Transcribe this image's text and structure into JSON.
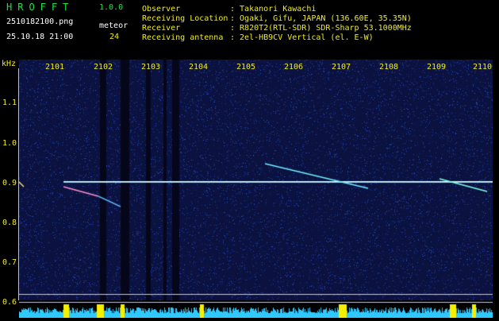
{
  "header": {
    "logo": "HROFFT",
    "version": "1.0.0",
    "filename": "2510182100.png",
    "datetime": "25.10.18 21:00",
    "meteor_label": "meteor",
    "meteor_count": "24",
    "info_labels": [
      "Observer",
      "Receiving Location",
      "Receiver",
      "Receiving antenna"
    ],
    "info_values": [
      ": Takanori Kawachi",
      ": Ogaki, Gifu, JAPAN (136.60E, 35.35N)",
      ": R820T2(RTL-SDR) SDR-Sharp 53.1000MHz",
      ": 2el-HB9CV Vertical (el. E-W)"
    ]
  },
  "axis": {
    "unit": "kHz",
    "y_ticks": [
      "1.1",
      "1.0",
      "0.9",
      "0.8",
      "0.7",
      "0.6"
    ],
    "x_ticks": [
      "2101",
      "2102",
      "2103",
      "2104",
      "2105",
      "2106",
      "2107",
      "2108",
      "2109",
      "2110"
    ]
  },
  "colors": {
    "background": "#000000",
    "spectrum_base": "#101a55",
    "text_green": "#19e34a",
    "text_yellow": "#f2ee10",
    "text_white": "#ffffff",
    "histogram_cyan": "#2fc8ff",
    "histogram_yellow": "#f4f000"
  }
}
